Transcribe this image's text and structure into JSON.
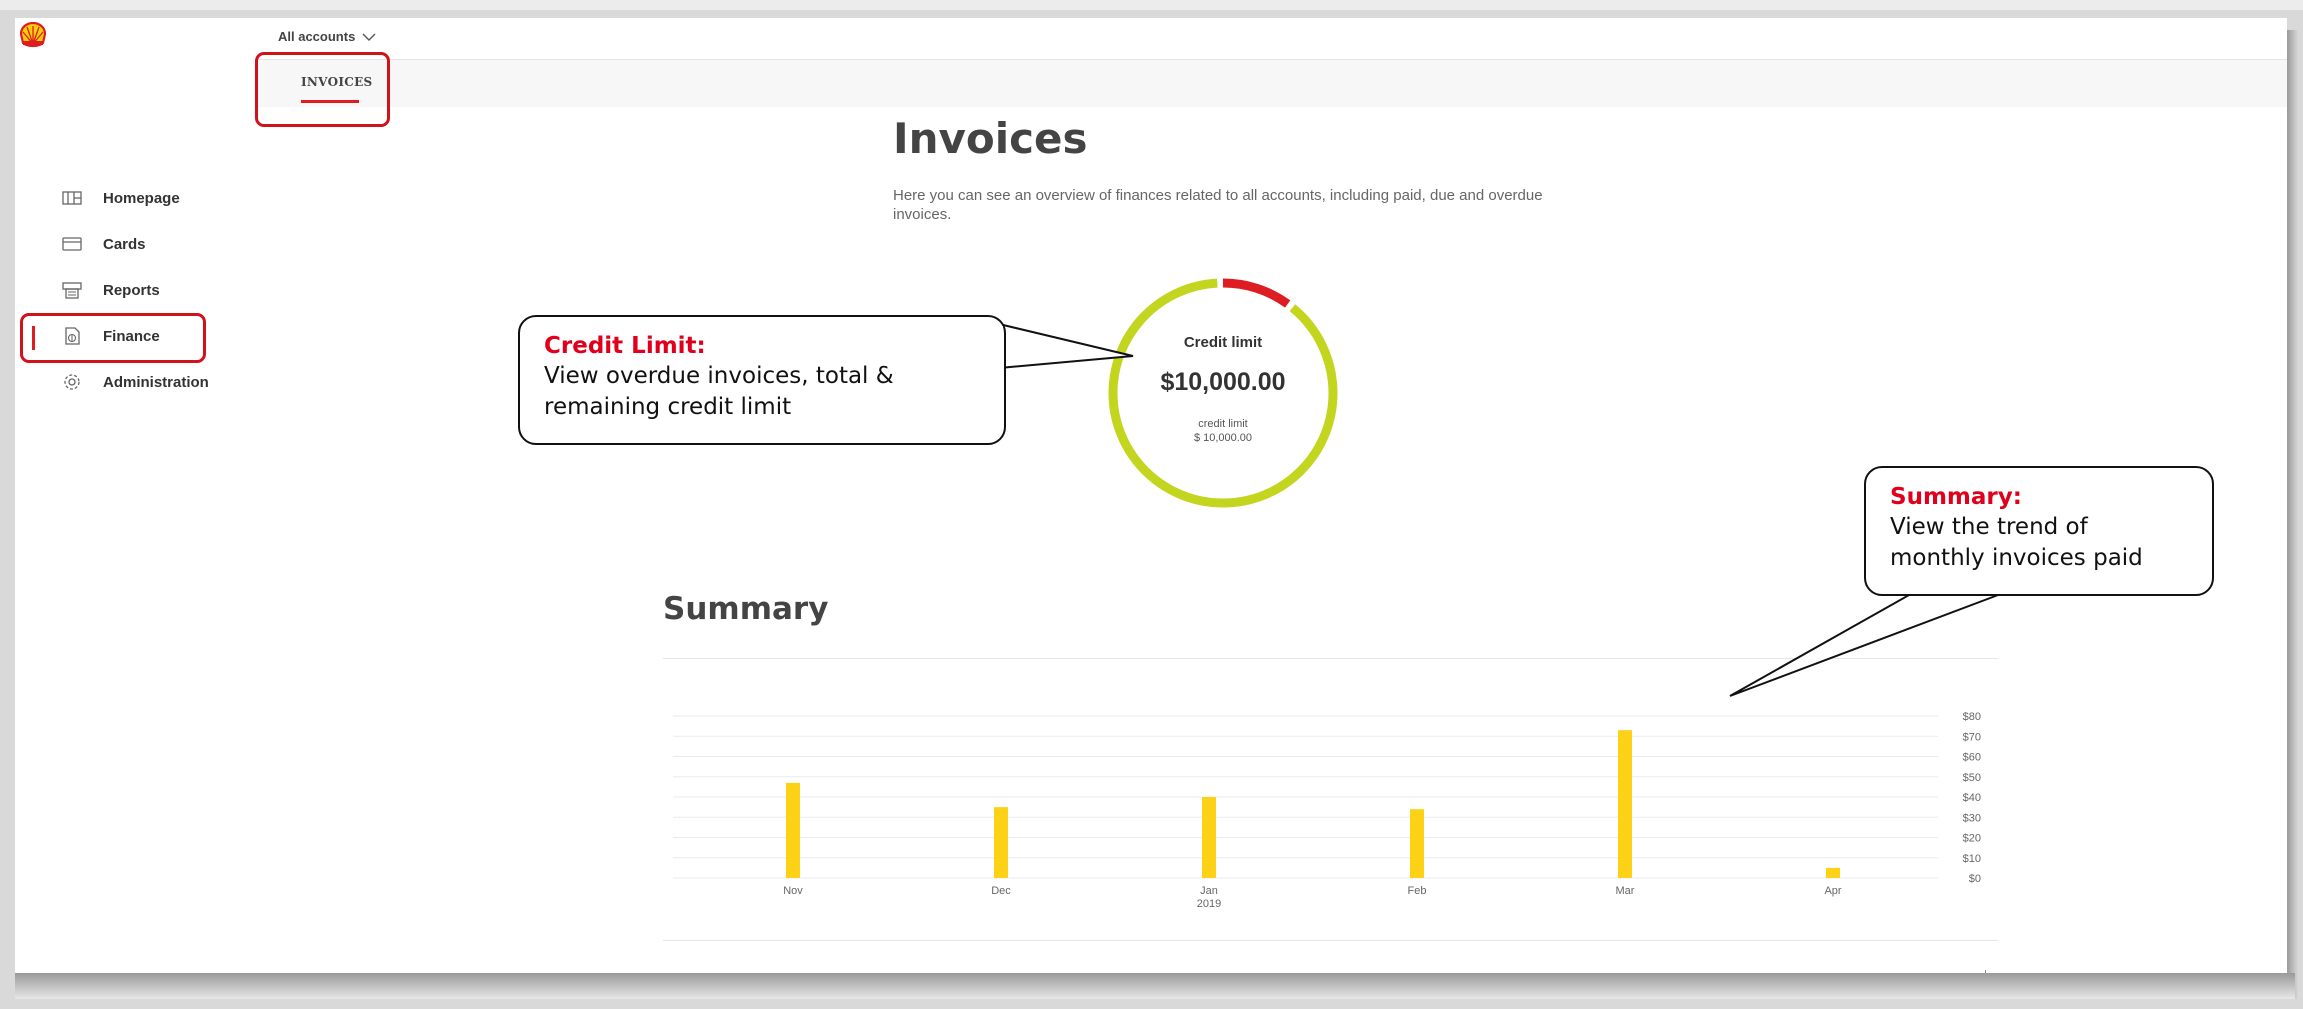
{
  "header": {
    "account_selector": "All accounts",
    "tabs": [
      {
        "label": "INVOICES",
        "active": true
      }
    ]
  },
  "sidebar": {
    "items": [
      {
        "label": "Homepage",
        "icon": "layout-icon"
      },
      {
        "label": "Cards",
        "icon": "card-icon"
      },
      {
        "label": "Reports",
        "icon": "reports-icon"
      },
      {
        "label": "Finance",
        "icon": "finance-icon",
        "active": true
      },
      {
        "label": "Administration",
        "icon": "gear-icon"
      }
    ]
  },
  "main": {
    "title": "Invoices",
    "description": "Here you can see an overview of finances related to all accounts, including paid, due and overdue invoices.",
    "credit": {
      "heading": "Credit limit",
      "amount": "$10,000.00",
      "sub_label": "credit limit",
      "sub_value": "$ 10,000.00",
      "overdue_fraction": 0.1,
      "colors": {
        "remaining": "#c3d51f",
        "overdue": "#dd1d21"
      }
    },
    "summary_title": "Summary"
  },
  "annotations": {
    "credit": {
      "title": "Credit Limit:",
      "line1": "View overdue invoices, total &",
      "line2": "remaining credit limit"
    },
    "summary": {
      "title": "Summary:",
      "line1": "View the trend of",
      "line2": "monthly invoices paid"
    }
  },
  "colors": {
    "accent": "#dd1d21",
    "bar": "#fcd116",
    "callout_title": "#e0001b"
  },
  "chart_data": {
    "type": "bar",
    "categories": [
      "Nov",
      "Dec",
      "Jan",
      "Feb",
      "Mar",
      "Apr"
    ],
    "category_sublabels": [
      "",
      "",
      "2019",
      "",
      "",
      ""
    ],
    "values": [
      47,
      35,
      40,
      34,
      73,
      5
    ],
    "yticks": [
      "$80",
      "$70",
      "$60",
      "$50",
      "$40",
      "$30",
      "$20",
      "$10",
      "$0"
    ],
    "ylim": [
      0,
      80
    ],
    "grid": true,
    "title": "",
    "xlabel": "",
    "ylabel": ""
  }
}
